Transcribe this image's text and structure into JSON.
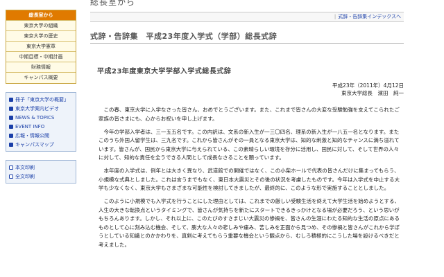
{
  "sidebar": {
    "menu": [
      {
        "label": "総長室から",
        "active": true
      },
      {
        "label": "東京大学の組織"
      },
      {
        "label": "東京大学の歴史"
      },
      {
        "label": "東京大学憲章"
      },
      {
        "label": "中期目標・中期計画"
      },
      {
        "label": "財務情報"
      },
      {
        "label": "キャンパス概要"
      }
    ],
    "links": [
      "冊子「東京大学の概要」",
      "東京大学案内ビデオ",
      "NEWS & TOPICS",
      "EVENT INFO",
      "広報・情報公開",
      "キャンパスマップ"
    ],
    "print": [
      "本文印刷",
      "全文印刷"
    ]
  },
  "header": {
    "title": "総長室から"
  },
  "topnav": {
    "index_link": "式辞・告辞集インデックスへ"
  },
  "page": {
    "title": "式辞・告辞集　平成23年度入学式（学部）総長式辞"
  },
  "speech": {
    "title": "平成23年度東京大学学部入学式総長式辞",
    "date": "平成23年（2011年）4月12日",
    "speaker": "東京大学総長　濱田　純一",
    "paragraphs": [
      "この春、東京大学に入学なさった皆さん、おめでとうございます。また、これまで皆さんの大変な受験勉強を支えてこられたご家族の皆さまにも、心からお祝いを申し上げます。",
      "今年の学部入学者は、三一五五名です。この内訳は、文系の新入生が一三〇四名、理系の新入生が一八五一名となります。またこのうち外国人留学生は、三九名です。これから皆さんがその一員となる東京大学は、知的な刺激と知的なチャンスに満ち溢れています。皆さんが、国民から東京大学に与えられている、この素晴らしい環境を存分に活用し、国民に対して、そして世界の人々に対して、知的な責任を全うできる人間として成長なさることを願っています。",
      "本年度の入学式は、例年とは大きく異なり、武道館での開催ではなく、この小柴ホールで代表の皆さんだけに集まってもらう、小規模な式典としました。これは言うまでもなく、東日本大震災とその後の状況を考慮したものです。今年は入学式を中止する大学も少なくなく、東京大学もさまざまな可能性を検討してきましたが、最終的に、このような形で実施することとしました。",
      "このように小規模でも入学式を行うことにした理由としては、これまでの厳しい受験生活を終えて大学生活を始めようとする、人生の大きな転換点というタイミングで、皆さんが気持ちを新たにスタートできるきっかけとなる場が必要だろう、という思いがもちろんあります。しかし、それ以上に、このたびのすさまじい大震災の惨禍を、皆さんの生涯にわたる知的な生活の原点にあるものとして心に刻み込む機会、そして、膨大な人々の悲しみや痛み、苦しみを正面から見つめ、その惨禍と皆さんがこれから学ぼうとしている知識とのかかわりを、真剣に考えてもらう重要な機会という観点から、むしろ積極的にこうした場を設けるべきだと考えました。"
    ]
  }
}
